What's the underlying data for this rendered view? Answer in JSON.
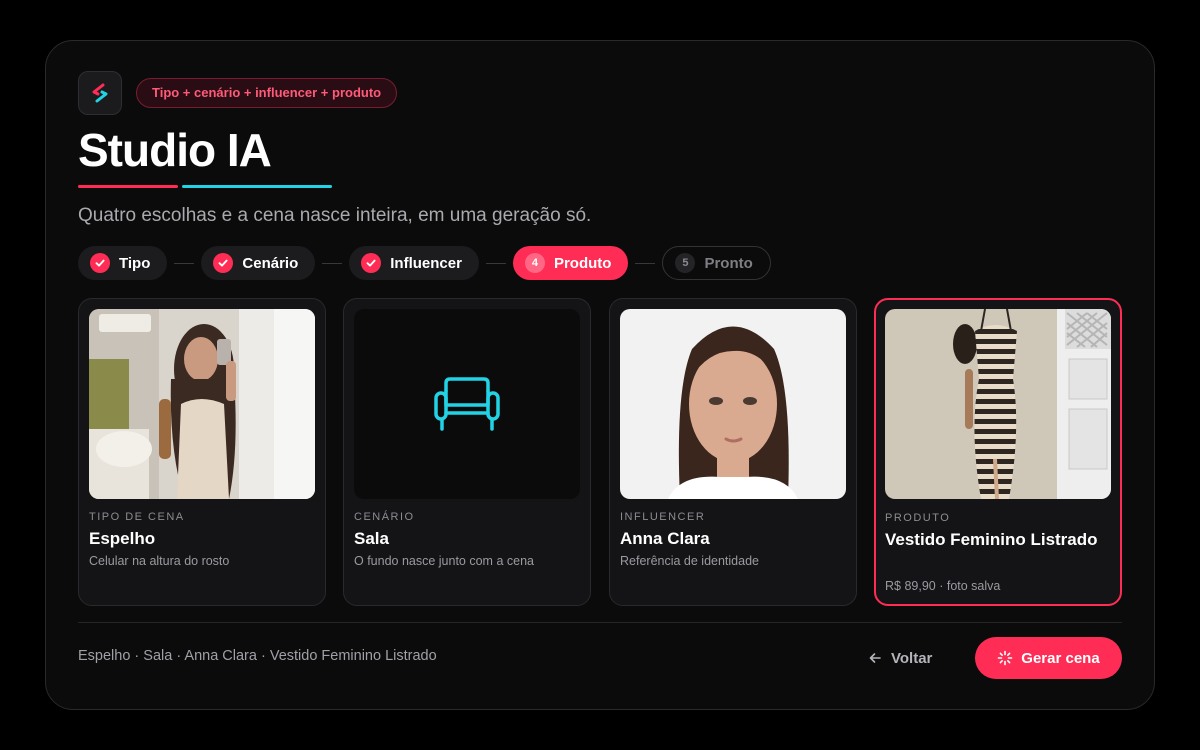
{
  "header": {
    "badge": "Tipo + cenário + influencer + produto",
    "title": "Studio IA",
    "subtitle": "Quatro escolhas e a cena nasce inteira, em uma geração só."
  },
  "colors": {
    "accent": "#ff2d55",
    "secondary": "#22d3e6",
    "background": "#0b0b0c"
  },
  "stepper": {
    "steps": [
      {
        "label": "Tipo",
        "state": "done"
      },
      {
        "label": "Cenário",
        "state": "done"
      },
      {
        "label": "Influencer",
        "state": "done"
      },
      {
        "label": "Produto",
        "state": "active",
        "number": "4"
      },
      {
        "label": "Pronto",
        "state": "pending",
        "number": "5"
      }
    ]
  },
  "cards": [
    {
      "kicker": "TIPO DE CENA",
      "name": "Espelho",
      "desc": "Celular na altura do rosto",
      "media": "mirror-selfie-photo"
    },
    {
      "kicker": "CENÁRIO",
      "name": "Sala",
      "desc": "O fundo nasce junto com a cena",
      "media": "sofa-icon"
    },
    {
      "kicker": "INFLUENCER",
      "name": "Anna Clara",
      "desc": "Referência de identidade",
      "media": "portrait-photo"
    },
    {
      "kicker": "PRODUTO",
      "name": "Vestido Feminino Listrado",
      "desc": "R$ 89,90 · foto salva",
      "media": "striped-dress-photo",
      "selected": true
    }
  ],
  "footer": {
    "summary": "Espelho · Sala · Anna Clara · Vestido Feminino Listrado",
    "back_label": "Voltar",
    "generate_label": "Gerar cena"
  }
}
